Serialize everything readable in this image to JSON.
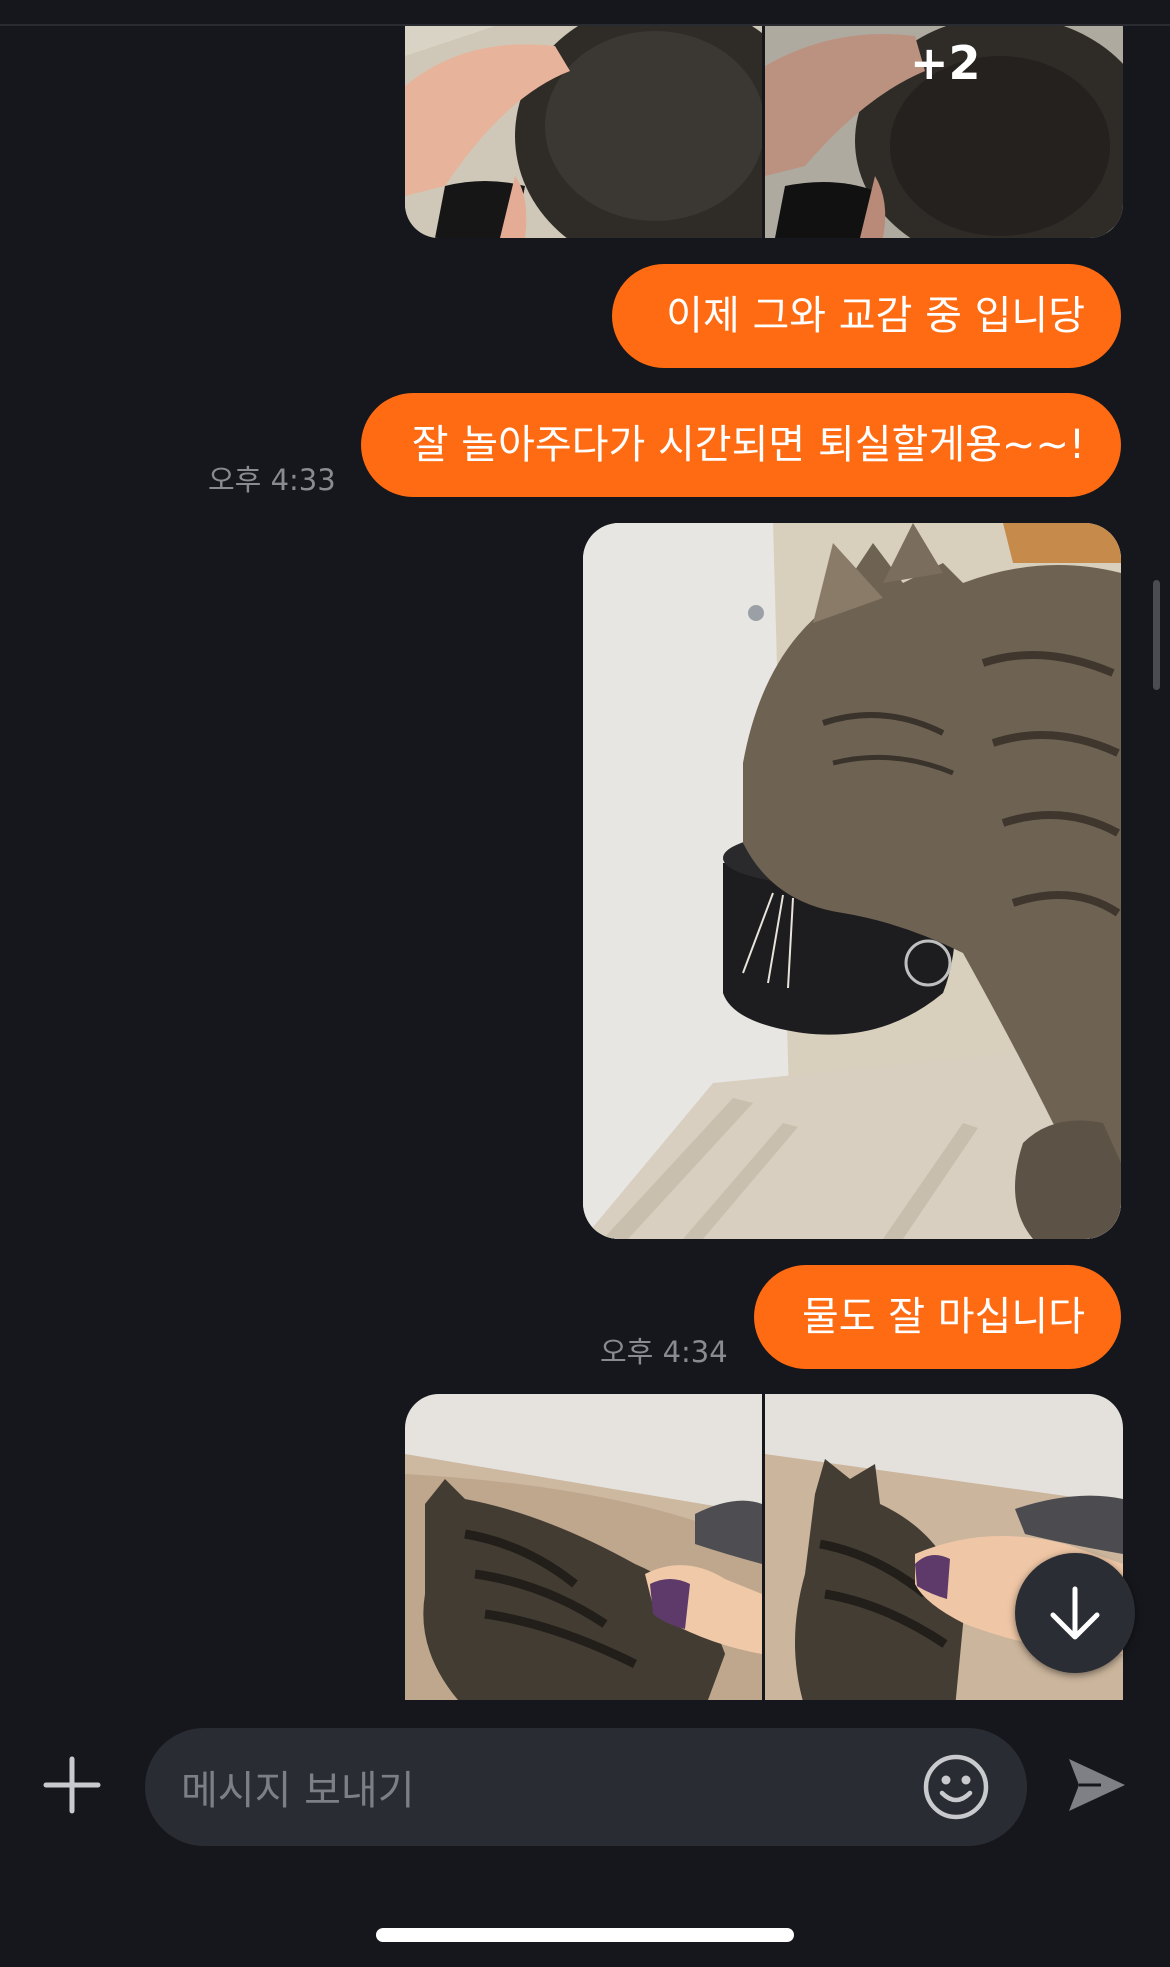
{
  "messages": {
    "photo_group_top": {
      "more_count": "+2"
    },
    "bubble_1": "이제 그와 교감 중 입니당",
    "bubble_2": "잘 놀아주다가 시간되면 퇴실할게용~~!",
    "time_1": "오후 4:33",
    "bubble_3": "물도 잘 마십니다",
    "time_2": "오후 4:34"
  },
  "composer": {
    "placeholder": "메시지 보내기"
  },
  "icons": {
    "add": "plus-icon",
    "emoji": "smiley-icon",
    "send": "send-icon",
    "scroll_down": "arrow-down-icon"
  },
  "colors": {
    "background": "#16171c",
    "bubble": "#ff6b12",
    "input_field": "#2a2c33",
    "timestamp": "#8a8b90"
  }
}
